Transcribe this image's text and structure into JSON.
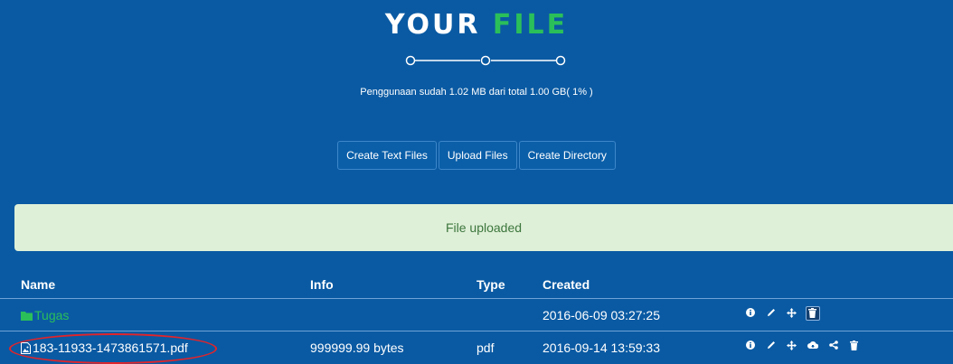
{
  "header": {
    "title_main": "YOUR",
    "title_accent": "FILE",
    "usage_text": "Penggunaan sudah 1.02 MB dari total 1.00 GB( 1% )"
  },
  "toolbar": {
    "create_text_label": "Create Text Files",
    "upload_label": "Upload Files",
    "create_dir_label": "Create Directory"
  },
  "alert": {
    "message": "File uploaded"
  },
  "table": {
    "columns": {
      "name": "Name",
      "info": "Info",
      "type": "Type",
      "created": "Created"
    },
    "rows": [
      {
        "name": "Tugas",
        "info": "",
        "type": "",
        "created": "2016-06-09 03:27:25",
        "kind": "folder"
      },
      {
        "name": "183-11933-1473861571.pdf",
        "info": "999999.99 bytes",
        "type": "pdf",
        "created": "2016-09-14 13:59:33",
        "kind": "file"
      }
    ]
  },
  "colors": {
    "panel": "#0a5aa3",
    "accent": "#2bbf5a",
    "alert_bg": "#dff0d8",
    "alert_text": "#3c763d",
    "annotation": "#e2242a"
  },
  "icons": [
    "info-icon",
    "pencil-icon",
    "move-icon",
    "trash-icon",
    "cloud-icon",
    "share-icon",
    "folder-icon",
    "file-image-icon"
  ]
}
